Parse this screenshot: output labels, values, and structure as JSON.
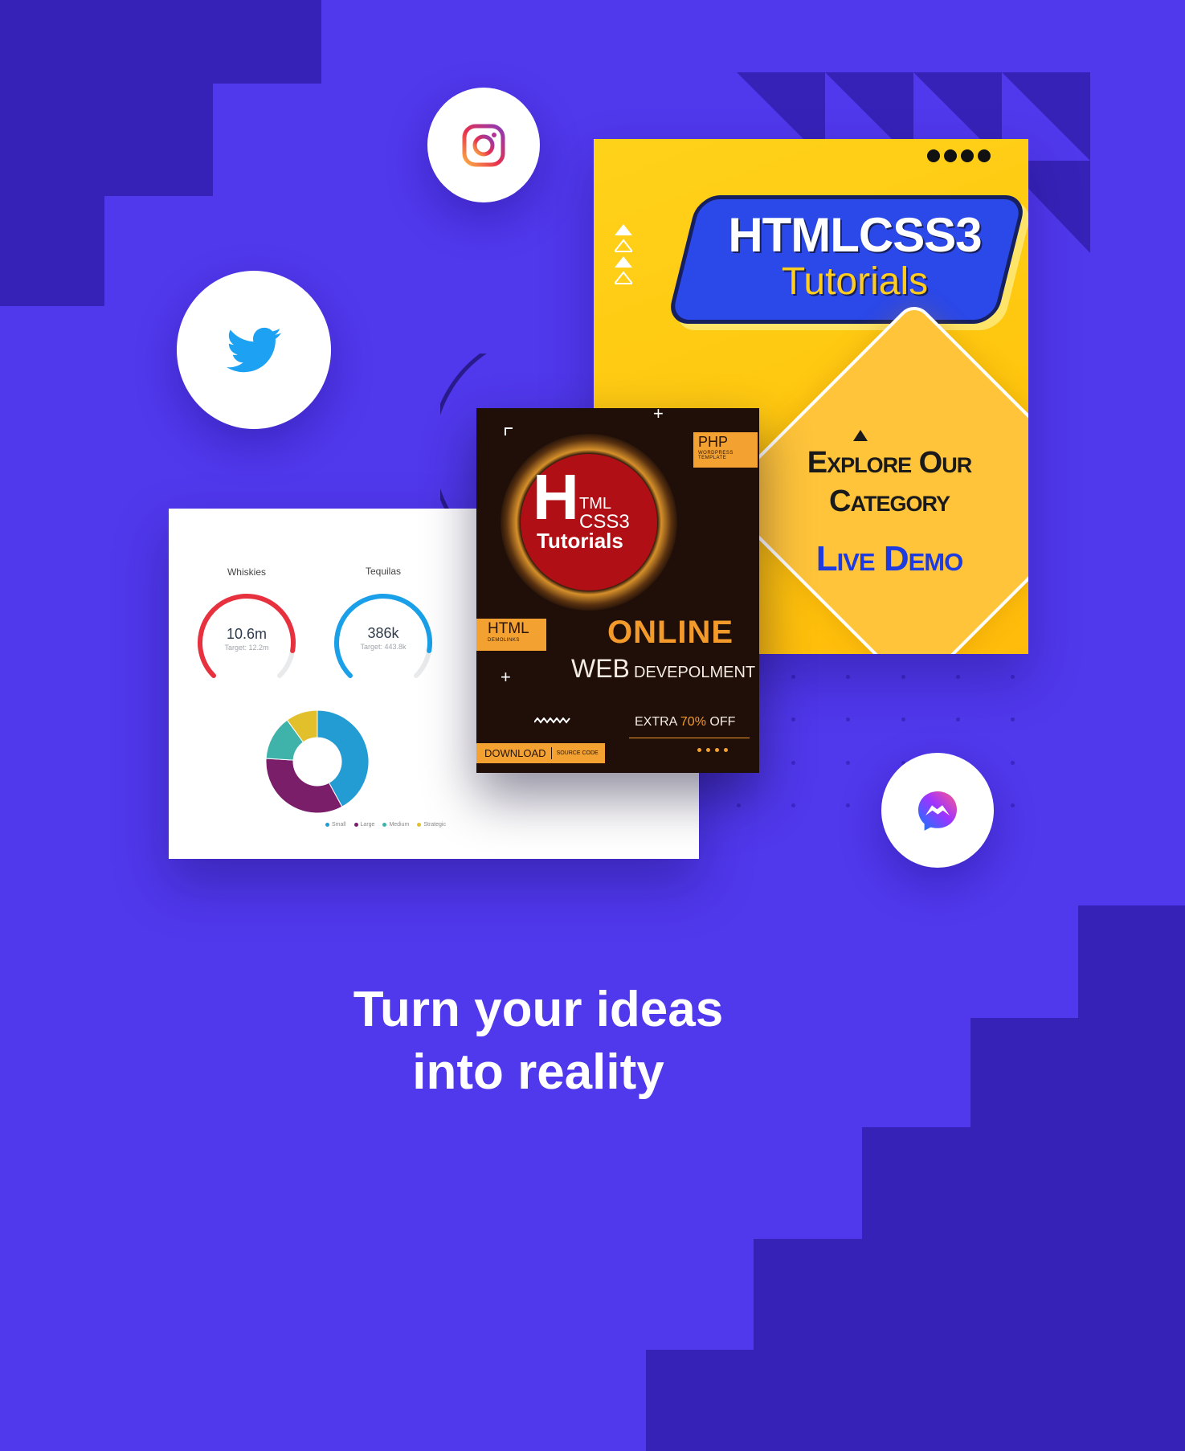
{
  "colors": {
    "background": "#5038ec",
    "stairs": "#3722b8",
    "card_yellow": "#ffc60e",
    "card_dark": "#1f0f08",
    "accent_orange": "#f39a2a"
  },
  "social_icons": {
    "instagram": "instagram-icon",
    "twitter": "twitter-icon",
    "messenger": "messenger-icon"
  },
  "dashboard": {
    "gauge1": {
      "title": "Whiskies",
      "value": "10.6m",
      "target": "Target: 12.2m",
      "fraction": 0.87,
      "color": "#e8313f"
    },
    "gauge2": {
      "title": "Tequilas",
      "value": "386k",
      "target": "Target: 443.8k",
      "fraction": 0.87,
      "color": "#1aa0e8"
    },
    "donut": {
      "segments": [
        {
          "label": "Small",
          "value": 42,
          "color": "#239bd3"
        },
        {
          "label": "Large",
          "value": 34,
          "color": "#7b1e6a"
        },
        {
          "label": "Medium",
          "value": 14,
          "color": "#3fb3a9"
        },
        {
          "label": "Strategic",
          "value": 10,
          "color": "#e2c02c"
        }
      ]
    }
  },
  "yellow_card": {
    "title_line1": "HTMLCSS3",
    "title_line2": "Tutorials",
    "explore_line1": "Explore Our",
    "explore_line2": "Category",
    "live_demo": "Live Demo"
  },
  "dark_card": {
    "logo_h": "H",
    "logo_tml": "TML",
    "logo_css": "CSS3",
    "logo_tutorials": "Tutorials",
    "php_tag": "PHP",
    "php_sub": "WORDPRESS",
    "php_sub2": "TEMPLATE",
    "html_tag": "HTML",
    "html_sub": "DEMOLINKS",
    "online": "ONLINE",
    "web": "WEB",
    "development": "DEVEPOLMENT",
    "extra_prefix": "EXTRA ",
    "extra_percent": "70%",
    "extra_suffix": " OFF",
    "download": "DOWNLOAD",
    "source_code": "SOURCE CODE"
  },
  "headline": {
    "line1": "Turn your ideas",
    "line2": "into reality"
  }
}
